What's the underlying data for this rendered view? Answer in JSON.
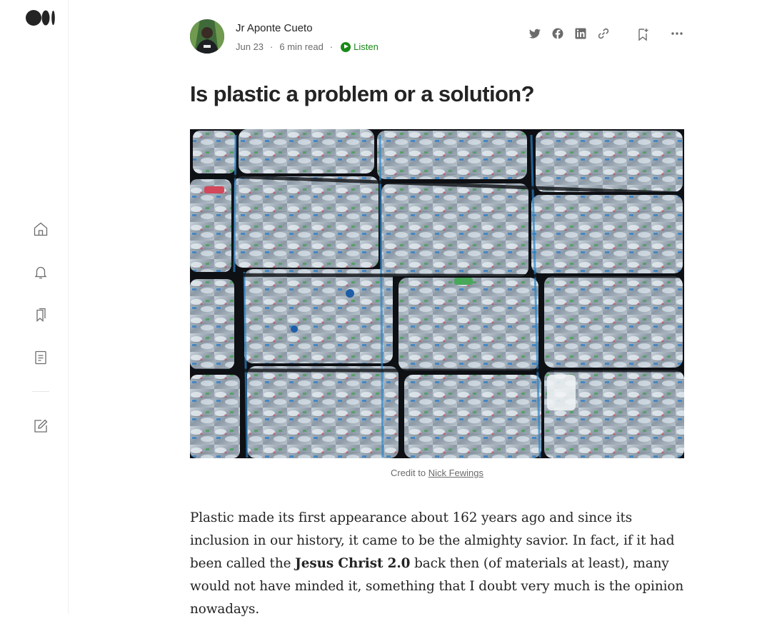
{
  "brand": {
    "logo_icon": "medium-logo-icon"
  },
  "rail": {
    "icons": [
      "home-icon",
      "bell-icon",
      "bookmarks-icon",
      "stories-icon",
      "write-icon"
    ]
  },
  "article": {
    "author": "Jr Aponte Cueto",
    "date": "Jun 23",
    "read_time": "6 min read",
    "listen_label": "Listen",
    "title": "Is plastic a problem or a solution?",
    "share_icons": [
      "twitter-icon",
      "facebook-icon",
      "linkedin-icon",
      "link-icon",
      "bookmark-add-icon",
      "more-icon"
    ],
    "caption_prefix": "Credit to ",
    "caption_link": "Nick Fewings",
    "paragraph_part1": "Plastic made its first appearance about 162 years ago and since its inclusion in our history, it came to be the almighty savior. In fact, if it had been called the ",
    "paragraph_bold": "Jesus Christ 2.0",
    "paragraph_part2": " back then (of materials at least), many would not have minded it, something that I doubt very much is the opinion nowadays."
  },
  "colors": {
    "accent_green": "#1a8917",
    "text": "#242424",
    "muted": "#6b6b6b"
  }
}
